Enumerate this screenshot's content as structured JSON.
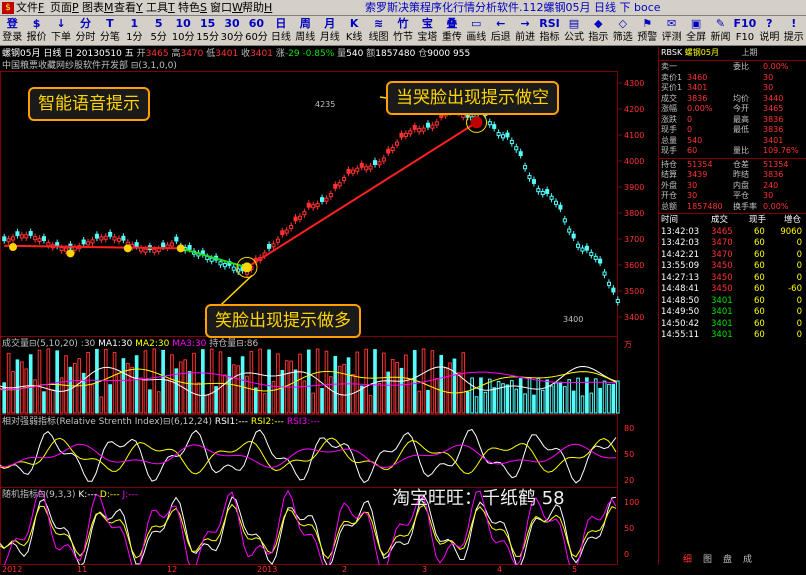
{
  "menubar": {
    "items": [
      {
        "label": "文件",
        "key": "F"
      },
      {
        "label": "页面",
        "key": "P"
      },
      {
        "label": "图表",
        "key": "M"
      },
      {
        "label": "查看",
        "key": "Y"
      },
      {
        "label": "工具",
        "key": "T"
      },
      {
        "label": "特色",
        "key": "S"
      },
      {
        "label": "窗口",
        "key": "W"
      },
      {
        "label": "帮助",
        "key": "H"
      }
    ],
    "app_title": "索罗斯决策程序化行情分析软件.112螺钢05月 日线 下 boce"
  },
  "toolbar": {
    "items": [
      {
        "icon": "登",
        "label": "登录"
      },
      {
        "icon": "$",
        "label": "报价"
      },
      {
        "icon": "↓",
        "label": "下单"
      },
      {
        "icon": "分",
        "label": "分时"
      },
      {
        "icon": "T",
        "label": "分笔"
      },
      {
        "icon": "1",
        "label": "1分"
      },
      {
        "icon": "5",
        "label": "5分"
      },
      {
        "icon": "10",
        "label": "10分"
      },
      {
        "icon": "15",
        "label": "15分"
      },
      {
        "icon": "30",
        "label": "30分"
      },
      {
        "icon": "60",
        "label": "60分"
      },
      {
        "icon": "日",
        "label": "日线"
      },
      {
        "icon": "周",
        "label": "周线"
      },
      {
        "icon": "月",
        "label": "月线"
      },
      {
        "icon": "K",
        "label": "K线"
      },
      {
        "icon": "≋",
        "label": "线图"
      },
      {
        "icon": "竹",
        "label": "竹节"
      },
      {
        "icon": "宝",
        "label": "宝塔"
      },
      {
        "icon": "叠",
        "label": "重传"
      },
      {
        "icon": "▭",
        "label": "画线"
      },
      {
        "icon": "←",
        "label": "后退"
      },
      {
        "icon": "→",
        "label": "前进"
      },
      {
        "icon": "RSI",
        "label": "指标"
      },
      {
        "icon": "▤",
        "label": "公式"
      },
      {
        "icon": "◆",
        "label": "指示"
      },
      {
        "icon": "◇",
        "label": "筛选"
      },
      {
        "icon": "⚑",
        "label": "预警"
      },
      {
        "icon": "✉",
        "label": "评测"
      },
      {
        "icon": "▣",
        "label": "全屏"
      },
      {
        "icon": "✎",
        "label": "新闻"
      },
      {
        "icon": "F10",
        "label": "F10"
      },
      {
        "icon": "?",
        "label": "说明"
      },
      {
        "icon": "!",
        "label": "提示"
      }
    ]
  },
  "chart": {
    "info_line": {
      "symbol": "螺钢05月",
      "period": "日线",
      "date": "日 20130510",
      "weekday": "五",
      "open_label": "开",
      "open": "3465",
      "high_label": "高",
      "high": "3470",
      "low_label": "低",
      "low": "3401",
      "close_label": "收",
      "close": "3401",
      "change_label": "涨",
      "change": "-29",
      "change_pct": "-0.85%",
      "volume_label": "量",
      "volume": "540",
      "amount_label": "额",
      "amount": "1857480",
      "position_label": "仓",
      "position": "9000",
      "extra": "955"
    },
    "indicator_name": "中国粮票收藏网纱股软件开发部 ⊟(3,1,0,0)",
    "price_labels": [
      "4300",
      "4200",
      "4100",
      "4000",
      "3900",
      "3800",
      "3700",
      "3600",
      "3500",
      "3400"
    ],
    "peak_label": "4235",
    "trough_label": "3400",
    "callouts": {
      "smart_voice": "智能语音提示",
      "cry_face": "当哭脸出现提示做空",
      "smile_face": "笑脸出现提示做多",
      "watermark": "淘宝旺旺：千纸鹤 58"
    },
    "volume_panel": {
      "title": "成交量",
      "params": "⊟(5,10,20) :30",
      "ma1": "MA1:30",
      "ma2": "MA2:30",
      "ma3": "MA3:30",
      "hold": "持仓量",
      "hold_value": "⊟:86",
      "unit": "万"
    },
    "rsi_panel": {
      "title": "相对强弱指标(Relative Strenth Index)",
      "params": "⊟(6,12,24)",
      "rsi1": "RSI1:---",
      "rsi2": "RSI2:---",
      "rsi3": "RSI3:---",
      "scale": [
        "80",
        "50",
        "20"
      ]
    },
    "kdj_panel": {
      "title": "随机指标",
      "params": "⊟(9,3,3)",
      "k": "K:---",
      "d": "D:---",
      "j": "J:---",
      "scale": [
        "100",
        "50",
        "0"
      ]
    },
    "x_axis": [
      {
        "label": "2012",
        "pos": 0
      },
      {
        "label": "11",
        "pos": 75
      },
      {
        "label": "12",
        "pos": 165
      },
      {
        "label": "2013",
        "pos": 255
      },
      {
        "label": "2",
        "pos": 340
      },
      {
        "label": "3",
        "pos": 420
      },
      {
        "label": "4",
        "pos": 495
      },
      {
        "label": "5",
        "pos": 570
      }
    ]
  },
  "right_panel": {
    "header_code": "RBSK",
    "header_name": "螺钢05月",
    "header_extra": "上期",
    "quote_rows": [
      {
        "l1": "卖一",
        "v1": "",
        "l2": "委比",
        "v2": "0.00%"
      },
      {
        "l1": "卖价1",
        "v1": "3460",
        "l2": "",
        "v2": "30"
      },
      {
        "l1": "买价1",
        "v1": "3401",
        "l2": "",
        "v2": "30"
      },
      {
        "l1": "成交",
        "v1": "3836",
        "l2": "均价",
        "v2": "3440"
      },
      {
        "l1": "涨幅",
        "v1": "0.00%",
        "l2": "今开",
        "v2": "3465"
      },
      {
        "l1": "涨跌",
        "v1": "0",
        "l2": "最高",
        "v2": "3836"
      },
      {
        "l1": "现手",
        "v1": "0",
        "l2": "最低",
        "v2": "3836"
      },
      {
        "l1": "总量",
        "v1": "540",
        "l2": "",
        "v2": "3401"
      },
      {
        "l1": "现手",
        "v1": "60",
        "l2": "量比",
        "v2": "109.76%"
      }
    ],
    "stat_rows": [
      {
        "l1": "持仓",
        "v1": "51354",
        "l2": "仓差",
        "v2": "51354"
      },
      {
        "l1": "结算",
        "v1": "3439",
        "l2": "昨结",
        "v2": "3836"
      },
      {
        "l1": "外盘",
        "v1": "30",
        "l2": "内盘",
        "v2": "240"
      },
      {
        "l1": "开仓",
        "v1": "30",
        "l2": "平仓",
        "v2": "30"
      },
      {
        "l1": "总额",
        "v1": "1857480",
        "l2": "换手率",
        "v2": "0.00%"
      }
    ],
    "trade_header": {
      "time": "时间",
      "price": "成交",
      "vol": "现手",
      "chg": "增仓"
    },
    "trades": [
      {
        "time": "13:42:03",
        "price": "3465",
        "vol": "60",
        "chg": "9060"
      },
      {
        "time": "13:42:03",
        "price": "3470",
        "vol": "60",
        "chg": "0"
      },
      {
        "time": "14:42:21",
        "price": "3470",
        "vol": "60",
        "chg": "0"
      },
      {
        "time": "13:55:09",
        "price": "3450",
        "vol": "60",
        "chg": "0"
      },
      {
        "time": "14:27:13",
        "price": "3450",
        "vol": "60",
        "chg": "0"
      },
      {
        "time": "14:48:41",
        "price": "3450",
        "vol": "60",
        "chg": "-60"
      },
      {
        "time": "14:48:50",
        "price": "3401",
        "vol": "60",
        "chg": "0"
      },
      {
        "time": "14:49:50",
        "price": "3401",
        "vol": "60",
        "chg": "0"
      },
      {
        "time": "14:50:42",
        "price": "3401",
        "vol": "60",
        "chg": "0"
      },
      {
        "time": "14:55:11",
        "price": "3401",
        "vol": "60",
        "chg": "0"
      }
    ],
    "tabs": [
      "细",
      "图",
      "盘",
      "成"
    ]
  }
}
